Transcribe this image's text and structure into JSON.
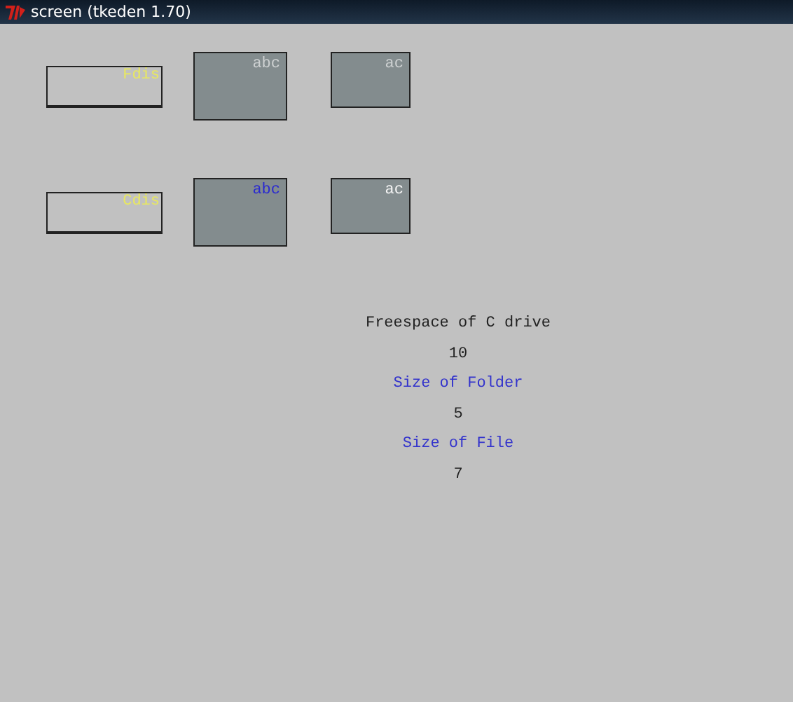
{
  "window": {
    "title": "screen (tkeden 1.70)"
  },
  "rows": [
    {
      "label": {
        "text": "Fdis",
        "color": "#e8e860"
      },
      "boxes": [
        {
          "text": "abc",
          "color": "#cdd0d1"
        },
        {
          "text": "ac",
          "color": "#cdd0d1"
        }
      ]
    },
    {
      "label": {
        "text": "Cdis",
        "color": "#e8e860"
      },
      "boxes": [
        {
          "text": "abc",
          "color": "#2a2ad0"
        },
        {
          "text": "ac",
          "color": "#f4f4f4"
        }
      ]
    }
  ],
  "texts": [
    {
      "text": "Freespace of C drive",
      "color": "#222222"
    },
    {
      "text": "10",
      "color": "#222222"
    },
    {
      "text": "Size of Folder",
      "color": "#3333cc"
    },
    {
      "text": "5",
      "color": "#222222"
    },
    {
      "text": "Size of File",
      "color": "#3333cc"
    },
    {
      "text": "7",
      "color": "#222222"
    }
  ]
}
